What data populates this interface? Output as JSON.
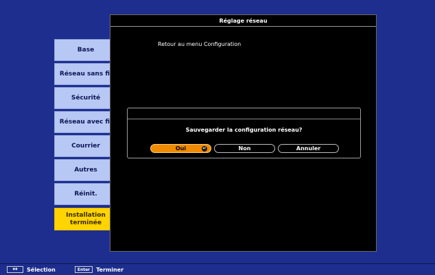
{
  "sidebar": {
    "items": [
      {
        "label": "Base"
      },
      {
        "label": "Réseau sans fil"
      },
      {
        "label": "Sécurité"
      },
      {
        "label": "Réseau avec fil"
      },
      {
        "label": "Courrier"
      },
      {
        "label": "Autres"
      },
      {
        "label": "Réinit."
      },
      {
        "label": "Installation\nterminée",
        "active": true
      }
    ]
  },
  "panel": {
    "title": "Réglage réseau",
    "back_label": "Retour au menu Configuration"
  },
  "dialog": {
    "question": "Sauvegarder la configuration réseau?",
    "buttons": {
      "yes": "Oui",
      "no": "Non",
      "cancel": "Annuler"
    },
    "selected": "yes"
  },
  "footer": {
    "select_label": "Sélection",
    "enter_key": "Enter",
    "finish_label": "Terminer"
  },
  "colors": {
    "background": "#1d2e8e",
    "sidebar_item": "#b8c8f4",
    "sidebar_active": "#ffd400",
    "selected_button": "#f08a00"
  }
}
